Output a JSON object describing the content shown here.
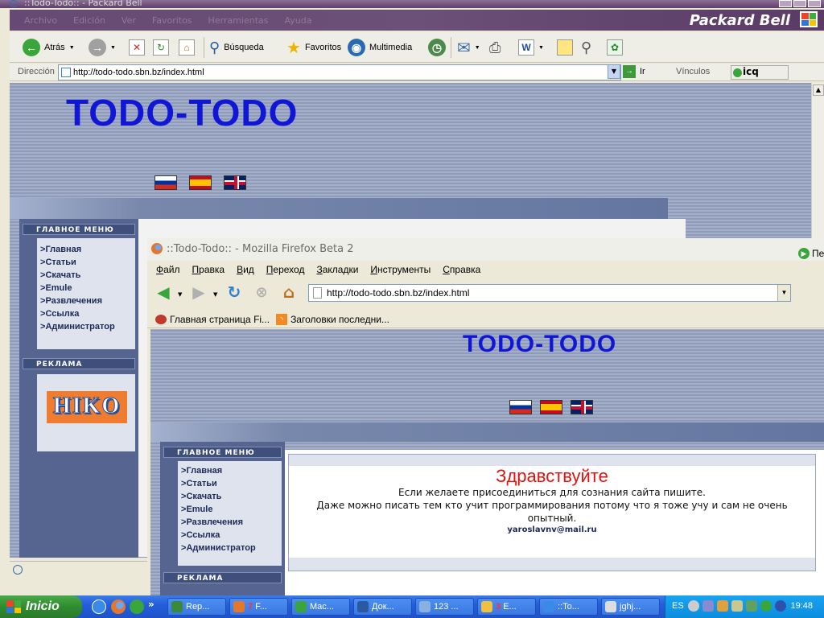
{
  "ie": {
    "title": "::Todo-Todo:: - Packard Bell",
    "menu": [
      "Archivo",
      "Edición",
      "Ver",
      "Favoritos",
      "Herramientas",
      "Ayuda"
    ],
    "brand": "Packard Bell",
    "toolbar": {
      "back": "Atrás",
      "search": "Búsqueda",
      "favorites": "Favoritos",
      "multimedia": "Multimedia"
    },
    "address_label": "Dirección",
    "url": "http://todo-todo.sbn.bz/index.html",
    "go": "Ir",
    "links": "Vínculos",
    "icq": "icq",
    "page": {
      "title": "TODO-TODO",
      "main_menu_head": "ГЛАВНОЕ МЕНЮ",
      "menu_items": [
        "Главная",
        "Статьи",
        "Скачать",
        "Emule",
        "Развлечения",
        "Ссылка",
        "Администратор"
      ],
      "ads_head": "РЕКЛАМА",
      "ad_logo": "HIKO"
    }
  },
  "ff": {
    "title": "::Todo-Todo:: - Mozilla Firefox Beta 2",
    "menu": [
      "Файл",
      "Правка",
      "Вид",
      "Переход",
      "Закладки",
      "Инструменты",
      "Справка"
    ],
    "url": "http://todo-todo.sbn.bz/index.html",
    "go": "Пе",
    "bookmarks": [
      "Главная страница Fi...",
      "Заголовки последни..."
    ],
    "page": {
      "title": "TODO-TODO",
      "main_menu_head": "ГЛАВНОЕ МЕНЮ",
      "menu_items": [
        "Главная",
        "Статьи",
        "Скачать",
        "Emule",
        "Развлечения",
        "Ссылка",
        "Администратор"
      ],
      "ads_head": "РЕКЛАМА",
      "welcome": "Здравствуйте",
      "line1": "Если желаете присоединиться для сознания сайта пишите.",
      "line2": "Даже можно писать тем кто учит программирования потому что я тоже учу и сам не очень опытный.",
      "email": "yaroslavnv@mail.ru"
    }
  },
  "taskbar": {
    "start": "Inicio",
    "tasks": [
      {
        "label": "Rep..."
      },
      {
        "num": "7",
        "label": "F..."
      },
      {
        "label": "Mac..."
      },
      {
        "label": "Док..."
      },
      {
        "label": "123 ..."
      },
      {
        "num": "3",
        "label": "E..."
      },
      {
        "label": "::To..."
      },
      {
        "label": "jghj..."
      }
    ],
    "lang": "ES",
    "clock": "19:48"
  },
  "colors": {
    "title_blue": "#0f16d6",
    "welcome_red": "#e3120f",
    "taskbar_blue": "#245edb",
    "start_green": "#2f8c2f"
  }
}
